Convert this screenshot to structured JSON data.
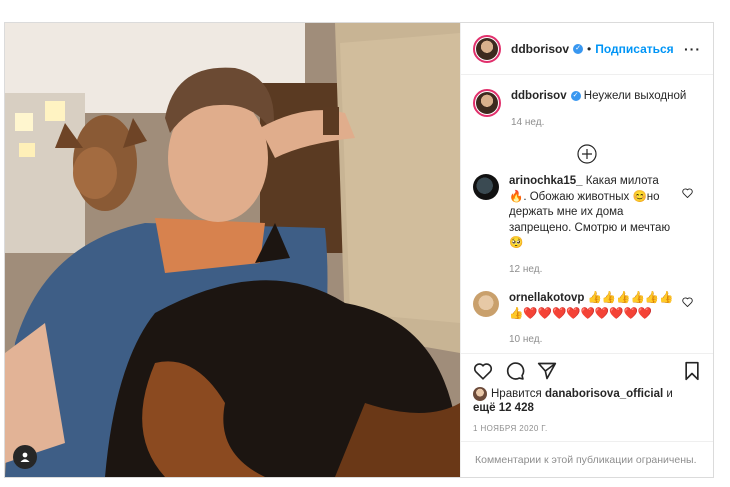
{
  "post": {
    "author": "ddborisov",
    "follow_label": "Подписаться",
    "separator": "•",
    "caption_author": "ddborisov",
    "caption_text": "Неужели выходной",
    "caption_time": "14 нед.",
    "comments": [
      {
        "user": "arinochka15_",
        "text": " Какая милота 🔥. Обожаю животных 😊но держать мне их дома запрещено. Смотрю и мечтаю 🥺",
        "time": "12 нед."
      },
      {
        "user": "ornellakotovp",
        "text": " 👍👍👍👍👍👍👍❤️❤️❤️❤️❤️❤️❤️❤️❤️",
        "time": "10 нед."
      }
    ],
    "likes_prefix": "Нравится ",
    "likes_user": "danaborisova_official",
    "likes_and": " и",
    "likes_more": "ещё 12 428",
    "date": "1 НОЯБРЯ 2020 Г.",
    "comments_closed": "Комментарии к этой публикации ограничены."
  },
  "icons": {
    "verified": "verified-badge-icon",
    "more": "more-options-icon",
    "add": "plus-circle-icon",
    "like": "heart-icon",
    "comment": "comment-icon",
    "share": "share-icon",
    "save": "bookmark-icon",
    "tag": "user-tag-icon"
  },
  "colors": {
    "accent": "#0095f6",
    "verified": "#3897f0",
    "ring": "#e1306c",
    "muted": "#8e8e8e"
  }
}
